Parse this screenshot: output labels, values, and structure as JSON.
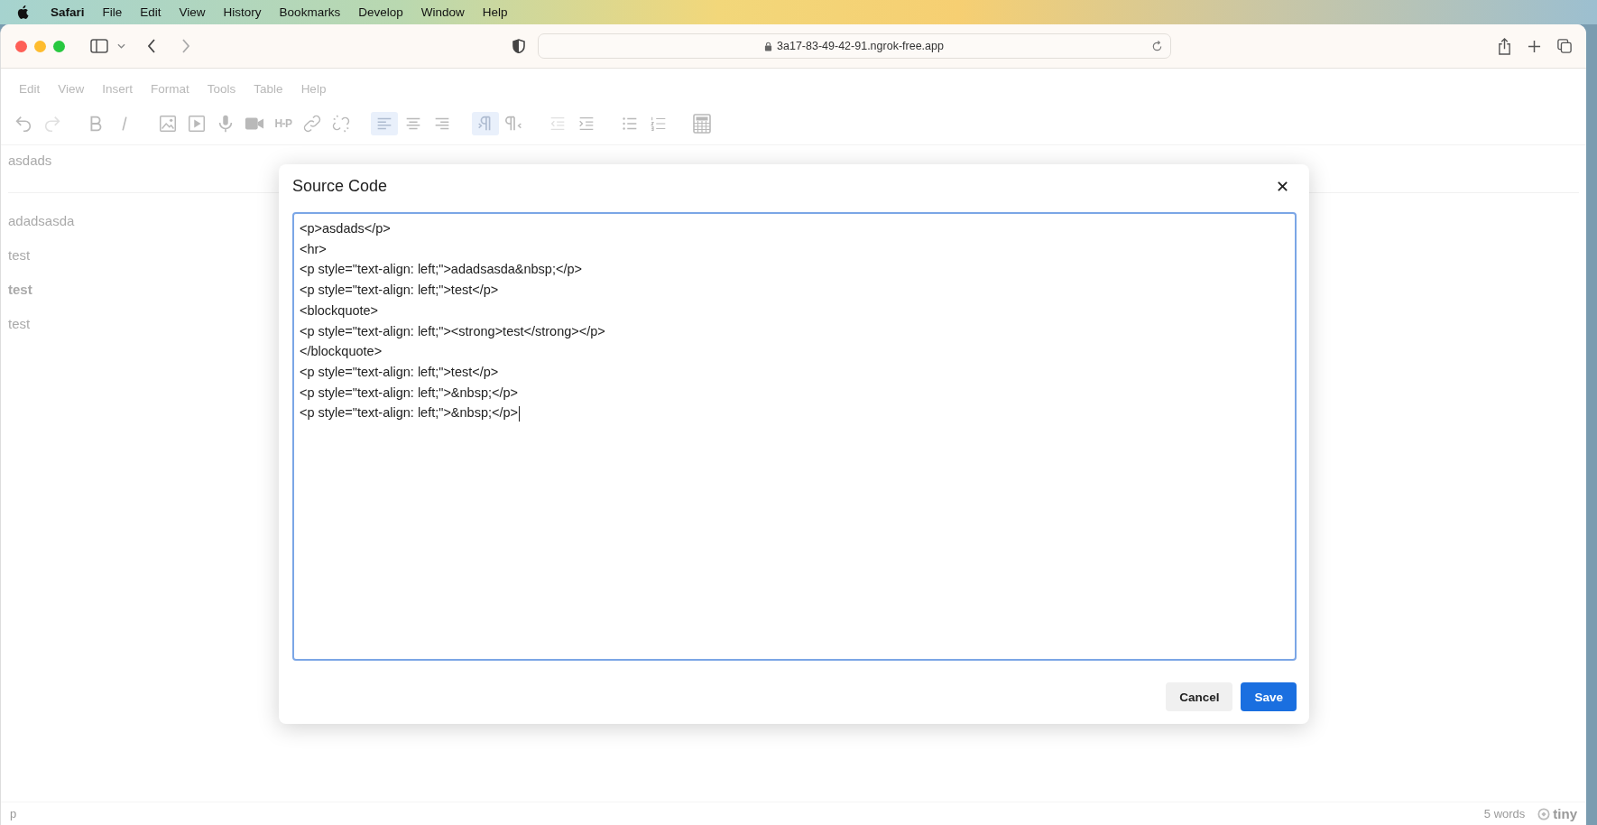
{
  "menubar": [
    {
      "label": "Safari",
      "kind": "app"
    },
    {
      "label": "File",
      "kind": "menu"
    },
    {
      "label": "Edit",
      "kind": "menu"
    },
    {
      "label": "View",
      "kind": "menu"
    },
    {
      "label": "History",
      "kind": "menu"
    },
    {
      "label": "Bookmarks",
      "kind": "menu"
    },
    {
      "label": "Develop",
      "kind": "menu"
    },
    {
      "label": "Window",
      "kind": "menu"
    },
    {
      "label": "Help",
      "kind": "menu"
    }
  ],
  "browser": {
    "url": "3a17-83-49-42-91.ngrok-free.app"
  },
  "editor": {
    "menu": [
      "Edit",
      "View",
      "Insert",
      "Format",
      "Tools",
      "Table",
      "Help"
    ],
    "toolbar": [
      {
        "buttons": [
          {
            "kind": "undo",
            "selected": false,
            "disabled": false
          },
          {
            "kind": "redo",
            "selected": false,
            "disabled": true
          }
        ]
      },
      {
        "buttons": [
          {
            "kind": "bold",
            "selected": false,
            "disabled": false
          },
          {
            "kind": "italic",
            "selected": false,
            "disabled": false
          }
        ]
      },
      {
        "buttons": [
          {
            "kind": "image",
            "selected": false,
            "disabled": false
          },
          {
            "kind": "media",
            "selected": false,
            "disabled": false
          },
          {
            "kind": "mic",
            "selected": false,
            "disabled": false
          },
          {
            "kind": "video",
            "selected": false,
            "disabled": false
          },
          {
            "kind": "h5p",
            "label": "H-P",
            "selected": false,
            "disabled": false
          },
          {
            "kind": "link",
            "selected": false,
            "disabled": false
          },
          {
            "kind": "unlink",
            "selected": false,
            "disabled": false
          }
        ]
      },
      {
        "buttons": [
          {
            "kind": "align-left",
            "selected": true,
            "disabled": false
          },
          {
            "kind": "align-center",
            "selected": false,
            "disabled": false
          },
          {
            "kind": "align-right",
            "selected": false,
            "disabled": false
          }
        ]
      },
      {
        "buttons": [
          {
            "kind": "ltr",
            "selected": true,
            "disabled": false
          },
          {
            "kind": "rtl",
            "selected": false,
            "disabled": false
          }
        ]
      },
      {
        "buttons": [
          {
            "kind": "outdent",
            "selected": false,
            "disabled": true
          },
          {
            "kind": "indent",
            "selected": false,
            "disabled": false
          }
        ]
      },
      {
        "buttons": [
          {
            "kind": "bullets",
            "selected": false,
            "disabled": false
          },
          {
            "kind": "numbers",
            "selected": false,
            "disabled": false
          }
        ]
      },
      {
        "buttons": [
          {
            "kind": "calculator",
            "selected": false,
            "disabled": false
          }
        ]
      }
    ],
    "content": [
      {
        "kind": "paragraph",
        "text": "asdads",
        "bold": false
      },
      {
        "kind": "rule"
      },
      {
        "kind": "paragraph",
        "text": "adadsasda",
        "bold": false
      },
      {
        "kind": "paragraph",
        "text": "test",
        "bold": false
      },
      {
        "kind": "paragraph",
        "text": "test",
        "bold": true
      },
      {
        "kind": "paragraph",
        "text": "test",
        "bold": false
      }
    ],
    "status_bar": {
      "path": "p",
      "word_count": "5 words",
      "brand": "tiny"
    }
  },
  "dialog": {
    "title": "Source Code",
    "code_lines": [
      "<p>asdads</p>",
      "<hr>",
      "<p style=\"text-align: left;\">adadsasda&nbsp;</p>",
      "<p style=\"text-align: left;\">test</p>",
      "<blockquote>",
      "<p style=\"text-align: left;\"><strong>test</strong></p>",
      "</blockquote>",
      "<p style=\"text-align: left;\">test</p>",
      "<p style=\"text-align: left;\">&nbsp;</p>",
      "<p style=\"text-align: left;\">&nbsp;</p>"
    ],
    "buttons": [
      {
        "label": "Cancel",
        "kind": "secondary"
      },
      {
        "label": "Save",
        "kind": "primary"
      }
    ]
  }
}
